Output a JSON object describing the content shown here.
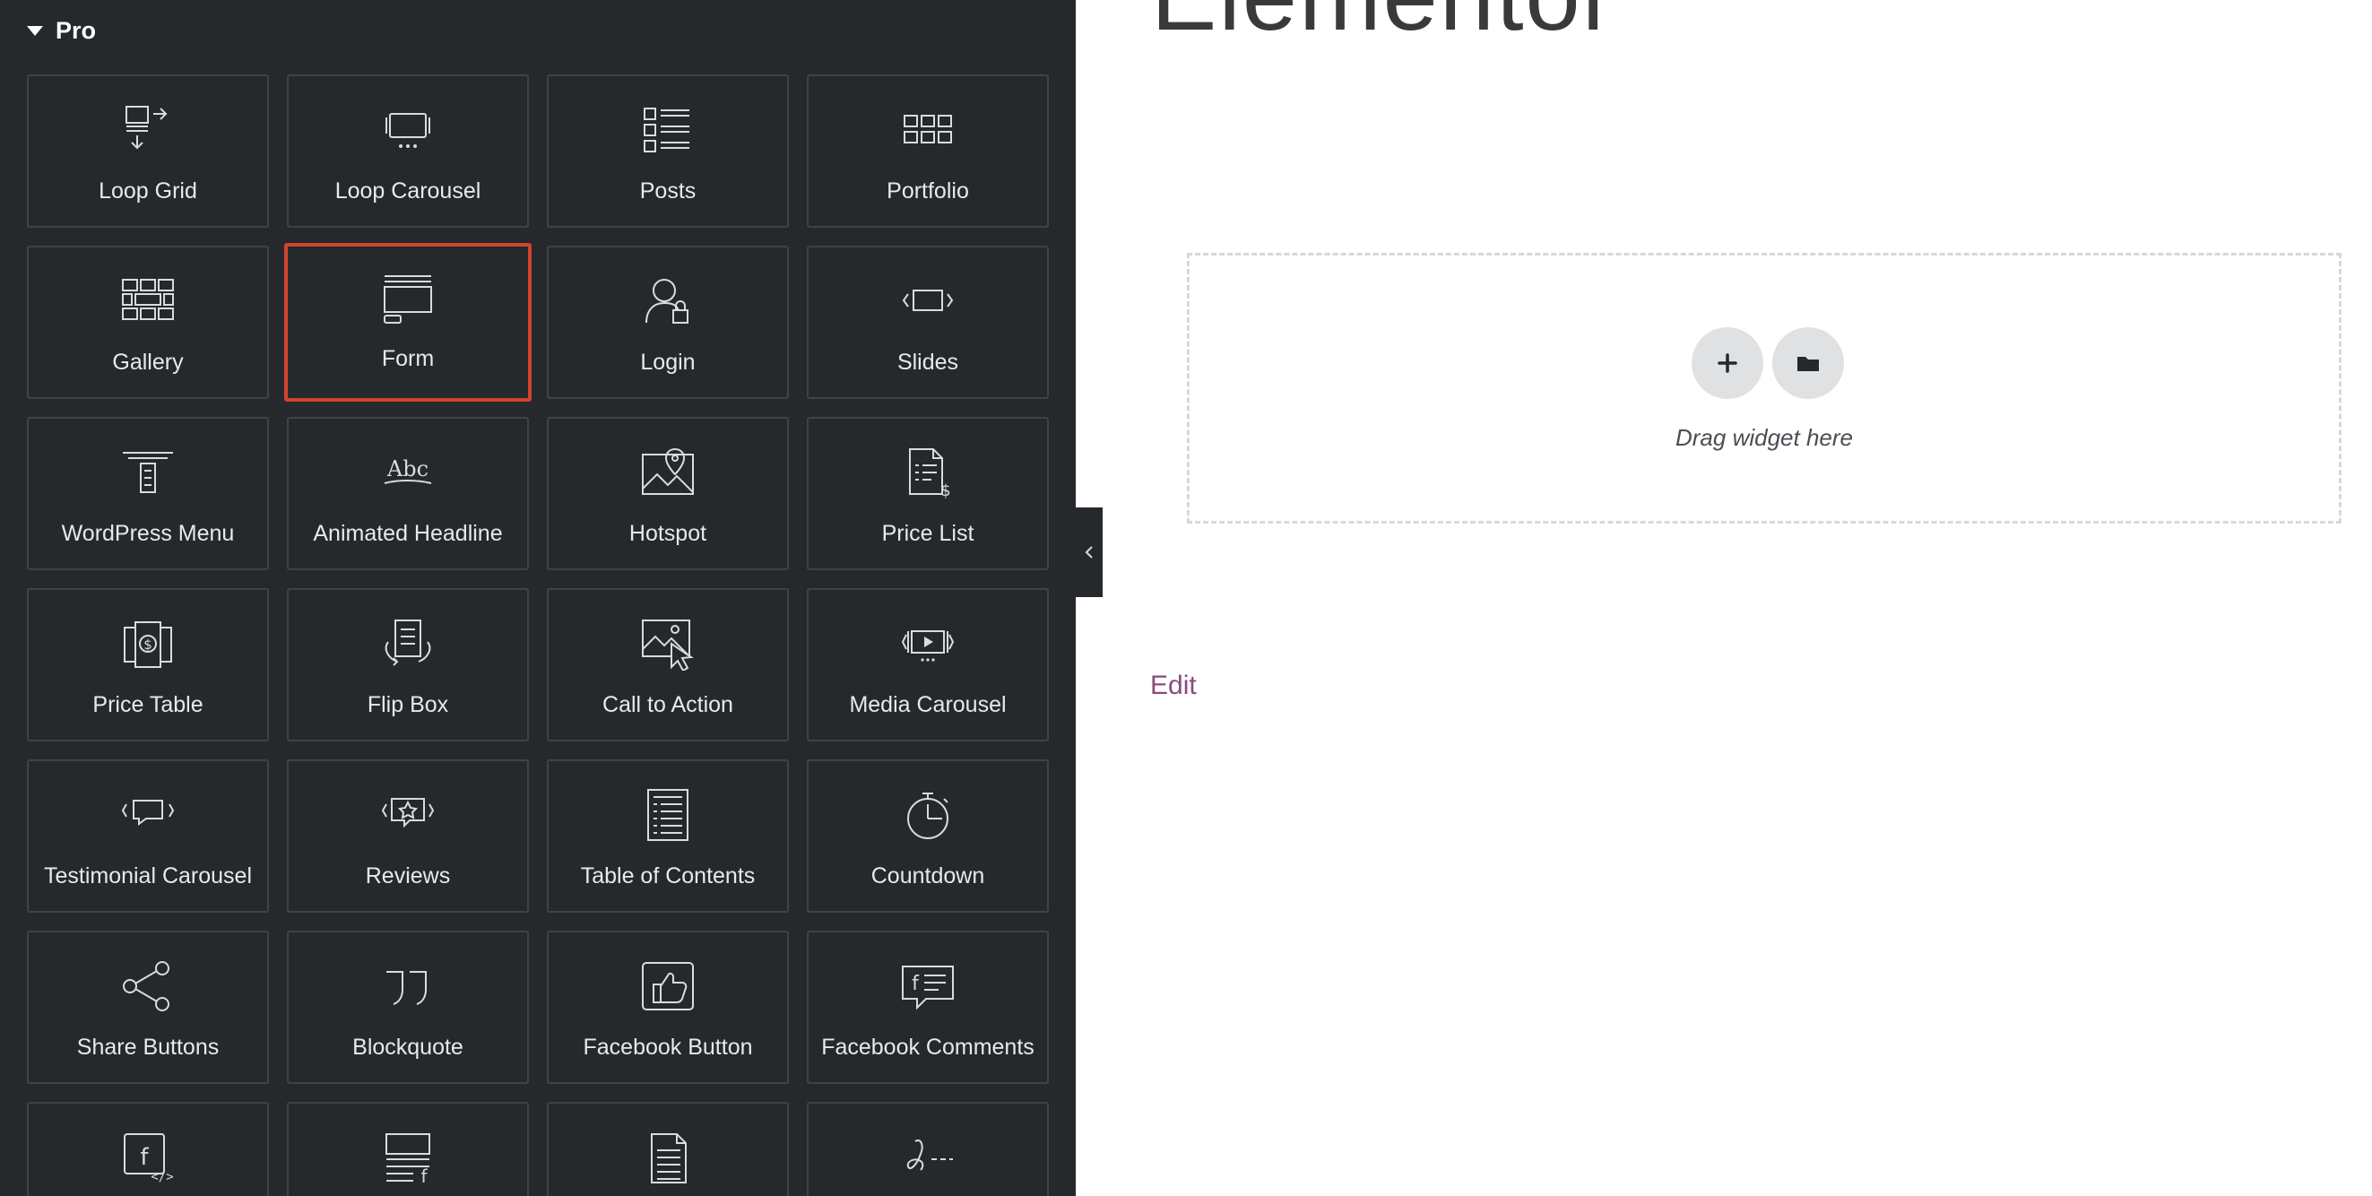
{
  "panel": {
    "section_title": "Pro",
    "widgets": [
      {
        "label": "Loop Grid",
        "icon": "loop-grid-icon"
      },
      {
        "label": "Loop Carousel",
        "icon": "loop-carousel-icon"
      },
      {
        "label": "Posts",
        "icon": "posts-icon"
      },
      {
        "label": "Portfolio",
        "icon": "portfolio-icon"
      },
      {
        "label": "Gallery",
        "icon": "gallery-icon"
      },
      {
        "label": "Form",
        "icon": "form-icon",
        "selected": true
      },
      {
        "label": "Login",
        "icon": "login-icon"
      },
      {
        "label": "Slides",
        "icon": "slides-icon"
      },
      {
        "label": "WordPress Menu",
        "icon": "wordpress-menu-icon"
      },
      {
        "label": "Animated Headline",
        "icon": "animated-headline-icon"
      },
      {
        "label": "Hotspot",
        "icon": "hotspot-icon"
      },
      {
        "label": "Price List",
        "icon": "price-list-icon"
      },
      {
        "label": "Price Table",
        "icon": "price-table-icon"
      },
      {
        "label": "Flip Box",
        "icon": "flip-box-icon"
      },
      {
        "label": "Call to Action",
        "icon": "call-to-action-icon"
      },
      {
        "label": "Media Carousel",
        "icon": "media-carousel-icon"
      },
      {
        "label": "Testimonial Carousel",
        "icon": "testimonial-carousel-icon"
      },
      {
        "label": "Reviews",
        "icon": "reviews-icon"
      },
      {
        "label": "Table of Contents",
        "icon": "table-of-contents-icon"
      },
      {
        "label": "Countdown",
        "icon": "countdown-icon"
      },
      {
        "label": "Share Buttons",
        "icon": "share-icon"
      },
      {
        "label": "Blockquote",
        "icon": "blockquote-icon"
      },
      {
        "label": "Facebook Button",
        "icon": "facebook-like-icon"
      },
      {
        "label": "Facebook Comments",
        "icon": "facebook-comments-icon"
      },
      {
        "label": "",
        "icon": "facebook-embed-icon"
      },
      {
        "label": "",
        "icon": "facebook-page-icon"
      },
      {
        "label": "",
        "icon": "document-icon"
      },
      {
        "label": "",
        "icon": "signature-icon"
      }
    ],
    "colors": {
      "panel_bg": "#26292c",
      "tile_border": "#3f4347",
      "selected_border": "#d0452b"
    }
  },
  "canvas": {
    "title": "Elementor",
    "drop_text": "Drag widget here",
    "add_button_icon": "plus-icon",
    "template_button_icon": "folder-icon",
    "edit_link": "Edit",
    "edit_link_color": "#8a4a7c"
  }
}
